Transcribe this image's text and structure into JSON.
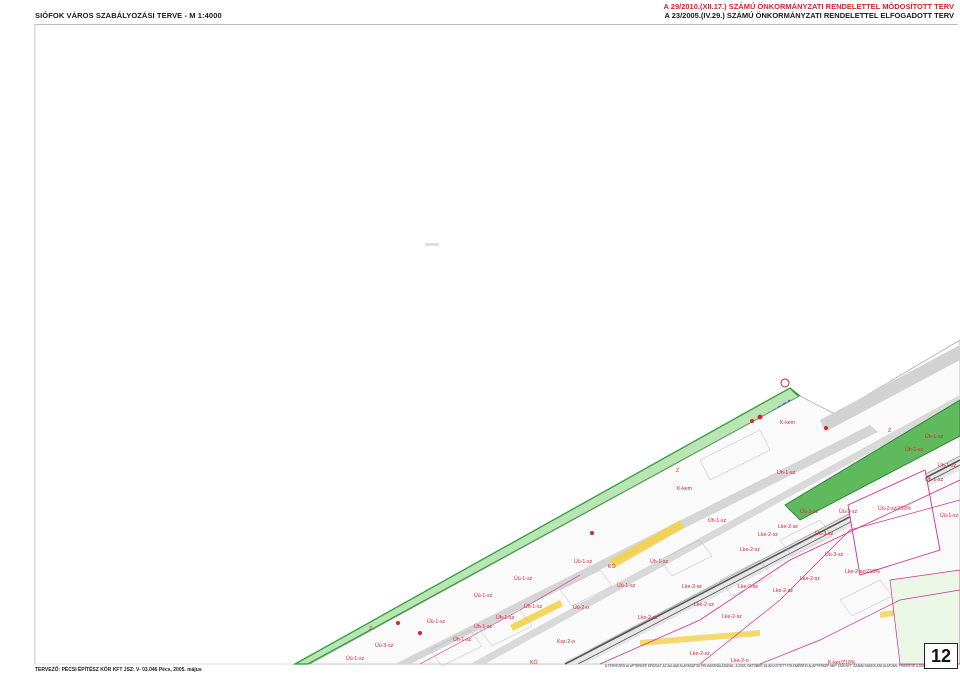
{
  "header": {
    "left_title": "SIÓFOK VÁROS SZABÁLYOZÁSI TERVE  -  M 1:4000",
    "right_line1": "A 29/2010.(XII.17.) SZÁMÚ ÖNKORMÁNYZATI RENDELETTEL MÓDOSÍTOTT TERV",
    "right_line2": "A 23/2005.(IV.29.) SZÁMÚ ÖNKORMÁNYZATI RENDELETTEL ELFOGADOTT TERV"
  },
  "footer": {
    "left": "TERVEZŐ: PÉCSI ÉPÍTÉSZ KÖR KFT  JSZ: V- 03.046  Pécs, 2005. május",
    "right_line1": "A TERVEZÉSI ALAPTÉRKÉP KÉSZÜLT AZ ÁLLAMI ALAPADATOK FELHASZNÁLÁSÁVAL, A 2003. OKTÓBER 16-ÁN KÖTETT FÖLDMÉRÉSI ALAPTÉRKÉP NKP 1334 NYT. SZÁMÚ MÁSOLATA ALAPJÁN, FRISSÍTVE A 2009 ÉVI ÁLLOMÁNNYAL",
    "sheet_number": "12"
  },
  "colors": {
    "heading_red": "#d8242b",
    "green_zone": "#2e9e3c",
    "green_fill": "#6fc46a",
    "road_grey": "#d5d5d5",
    "rail_dark": "#555555",
    "magenta": "#d12f8a",
    "yellow_road": "#f2d24a",
    "blue_boundary": "#2c4fd6"
  },
  "map_labels": [
    {
      "text": "K-kem"
    },
    {
      "text": "K-kem"
    },
    {
      "text": "Z"
    },
    {
      "text": "Z"
    },
    {
      "text": "Z"
    },
    {
      "text": "Üh-1-sz"
    },
    {
      "text": "Üh-1-sz"
    },
    {
      "text": "Üh-1-sz"
    },
    {
      "text": "Üh-1-sz"
    },
    {
      "text": "Üh-1-sz"
    },
    {
      "text": "Üh-1-sz"
    },
    {
      "text": "Üh-1-sz"
    },
    {
      "text": "Üü-1-sz"
    },
    {
      "text": "Üü-1-sz"
    },
    {
      "text": "Üü-1-sz"
    },
    {
      "text": "Üü-1-sz"
    },
    {
      "text": "Üü-1-sz"
    },
    {
      "text": "Üü-1-sz"
    },
    {
      "text": "Üü-3-sz"
    },
    {
      "text": "Üü-3-sz"
    },
    {
      "text": "Üü-3-sz"
    },
    {
      "text": "Üü-3-sz"
    },
    {
      "text": "Üü-3-sz"
    },
    {
      "text": "Üü-2-sz/Z10%"
    },
    {
      "text": "Lke-2-sz"
    },
    {
      "text": "Lke-2-sz"
    },
    {
      "text": "Lke-2-sz"
    },
    {
      "text": "Lke-2-sz"
    },
    {
      "text": "Lke-2-sz"
    },
    {
      "text": "Lke-2-sz"
    },
    {
      "text": "Lke-2-sz"
    },
    {
      "text": "Lke-2-sz"
    },
    {
      "text": "Lke-2-sz/Z10%"
    },
    {
      "text": "K-ker/Z10%"
    },
    {
      "text": "KÖ"
    },
    {
      "text": "KÖ"
    },
    {
      "text": "Üh-1-sz"
    },
    {
      "text": "Üh-1-sz"
    },
    {
      "text": "Üh-1-sz"
    },
    {
      "text": "Lke-2-sz"
    },
    {
      "text": "Lke-2-sz"
    },
    {
      "text": "Lke-2-sz"
    },
    {
      "text": "Üh-1-sz"
    },
    {
      "text": "Üü-1-sz"
    },
    {
      "text": "Üü-2-o"
    },
    {
      "text": "Ksz-2-o"
    },
    {
      "text": "Lke-2-o"
    }
  ]
}
